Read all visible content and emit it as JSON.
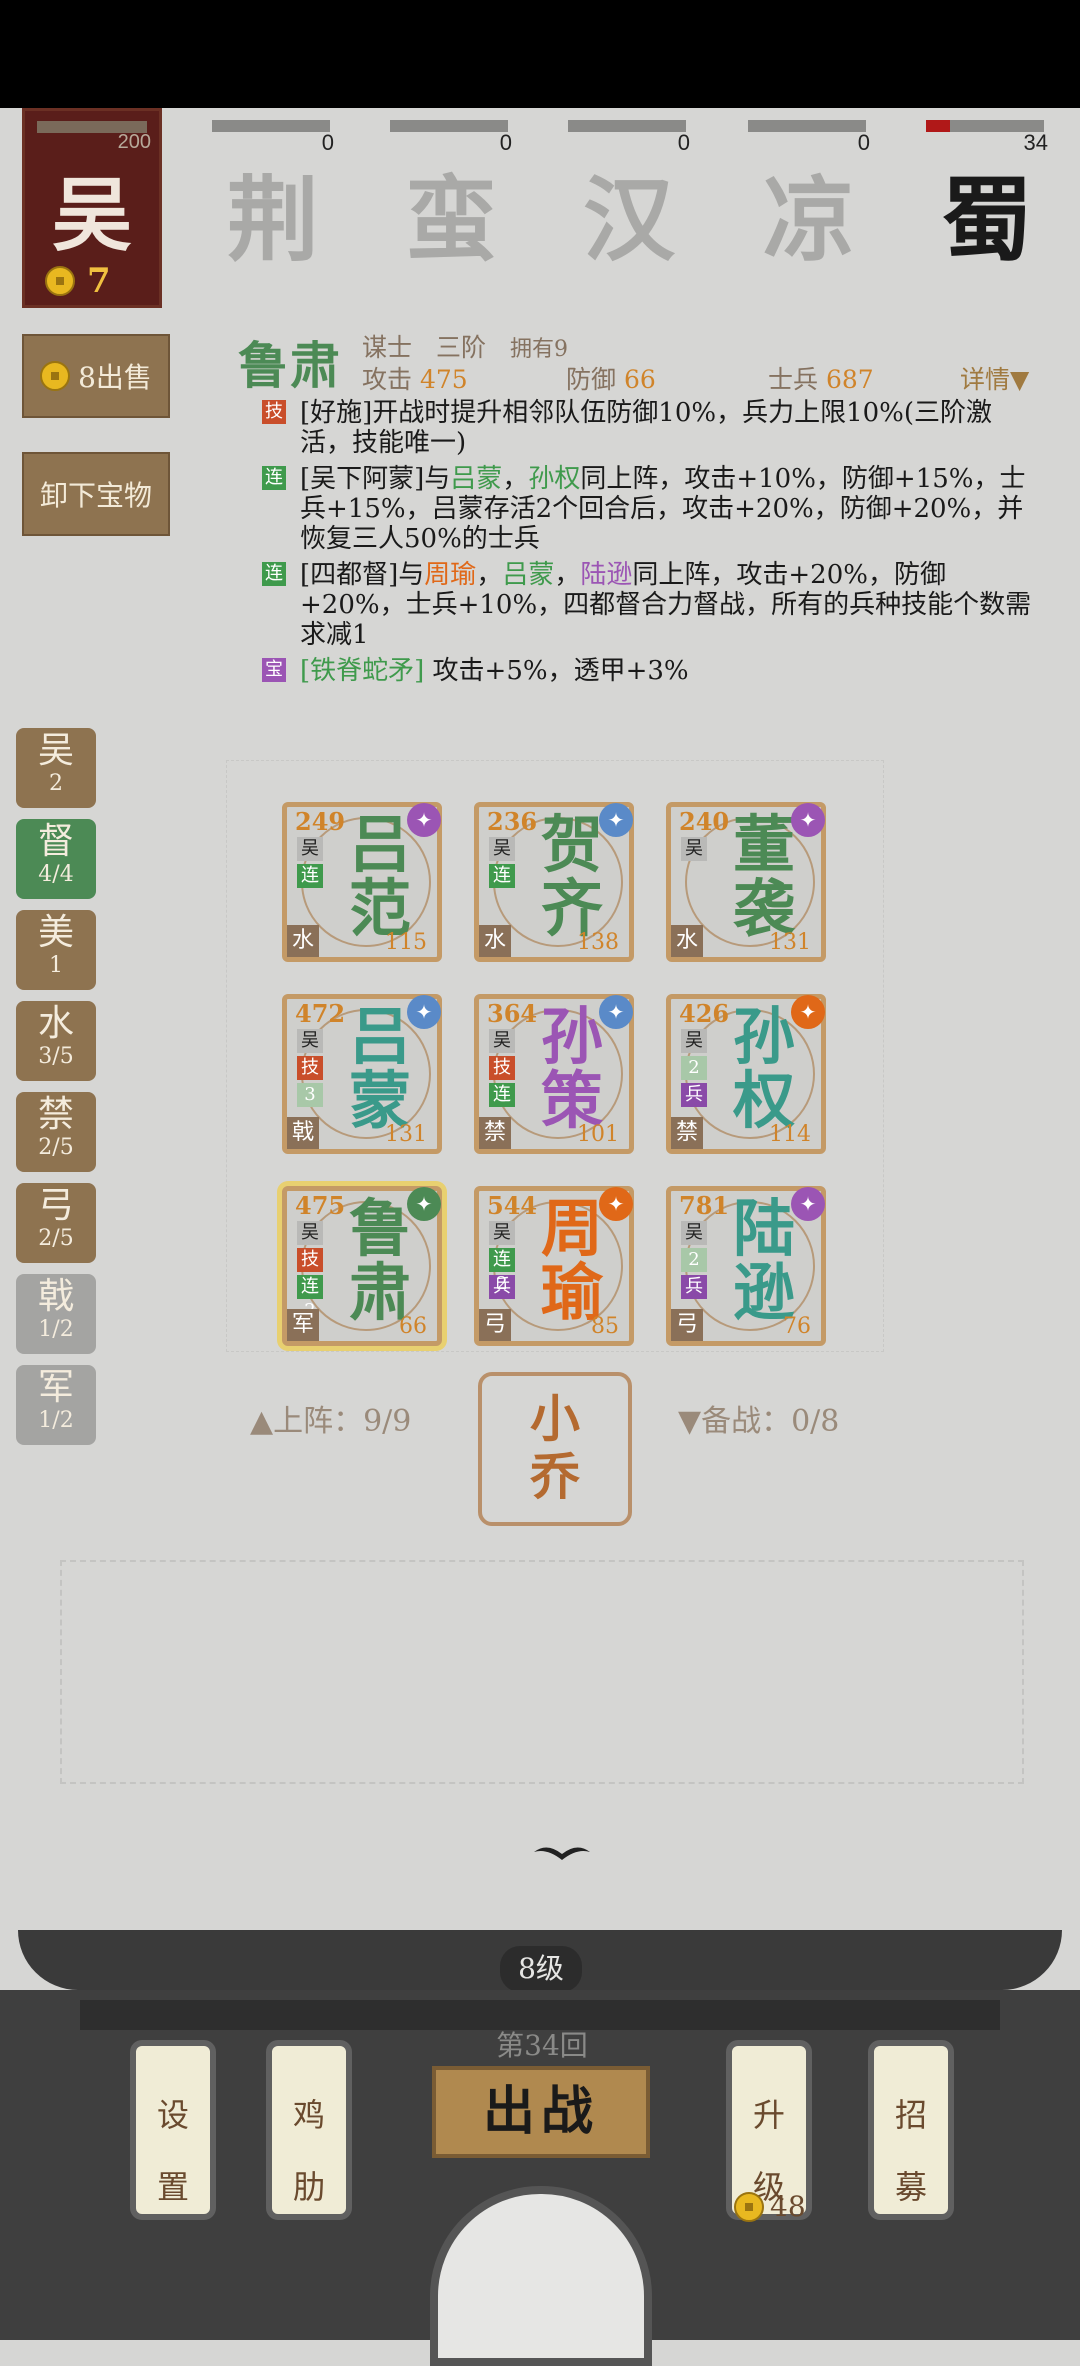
{
  "player": {
    "faction": "吴",
    "hp": "200",
    "coins": "7"
  },
  "enemies": [
    {
      "name": "荆",
      "score": "0",
      "fill": 0
    },
    {
      "name": "蛮",
      "score": "0",
      "fill": 0
    },
    {
      "name": "汉",
      "score": "0",
      "fill": 0
    },
    {
      "name": "凉",
      "score": "0",
      "fill": 0
    },
    {
      "name": "蜀",
      "score": "34",
      "fill": 0.2
    }
  ],
  "buttons": {
    "sell": "8出售",
    "unequip": "卸下宝物"
  },
  "general": {
    "name": "鲁肃",
    "role": "谋士",
    "rank": "三阶",
    "owned": "拥有9",
    "atk_label": "攻击",
    "atk": "475",
    "def_label": "防御",
    "def": "66",
    "troops_label": "士兵",
    "troops": "687",
    "detail": "详情"
  },
  "skills": [
    {
      "tag": "技",
      "color": "#c94e2a",
      "text": "[好施]开战时提升相邻队伍防御10%，兵力上限10%(三阶激活，技能唯一)"
    },
    {
      "tag": "连",
      "color": "#3f9a4c",
      "p1": "[吴下阿蒙]与",
      "n1": "吕蒙",
      "p2": "，",
      "n2": "孙权",
      "p3": "同上阵，攻击+10%，防御+15%，士兵+15%，吕蒙存活2个回合后，攻击+20%，防御+20%，并恢复三人50%的士兵"
    },
    {
      "tag": "连",
      "color": "#3f9a4c",
      "p1": "[四都督]与",
      "n1": "周瑜",
      "p2": "，",
      "n2": "吕蒙",
      "p3": "，",
      "n3": "陆逊",
      "p4": "同上阵，攻击+20%，防御+20%，士兵+10%，四都督合力督战，所有的兵种技能个数需求减1"
    },
    {
      "tag": "宝",
      "color": "#9b55b4",
      "p1": "[铁脊蛇矛]",
      "p2": " 攻击+5%，透甲+3%"
    }
  ],
  "filters": [
    {
      "label": "吴",
      "count": "2",
      "style": "brown"
    },
    {
      "label": "督",
      "count": "4/4",
      "style": "green"
    },
    {
      "label": "美",
      "count": "1",
      "style": "brown"
    },
    {
      "label": "水",
      "count": "3/5",
      "style": "brown"
    },
    {
      "label": "禁",
      "count": "2/5",
      "style": "brown"
    },
    {
      "label": "弓",
      "count": "2/5",
      "style": "brown"
    },
    {
      "label": "戟",
      "count": "1/2",
      "style": "gray"
    },
    {
      "label": "军",
      "count": "1/2",
      "style": "gray"
    }
  ],
  "units": [
    {
      "c1": "吕",
      "c2": "范",
      "hp": "249",
      "atk": "115",
      "type": "水",
      "tags": [
        "吴",
        "连"
      ],
      "color": "#4c8a55",
      "badge": "#9b55b4"
    },
    {
      "c1": "贺",
      "c2": "齐",
      "hp": "236",
      "atk": "138",
      "type": "水",
      "tags": [
        "吴",
        "连"
      ],
      "color": "#4c8a55",
      "badge": "#5a8ac8"
    },
    {
      "c1": "董",
      "c2": "袭",
      "hp": "240",
      "atk": "131",
      "type": "水",
      "tags": [
        "吴"
      ],
      "color": "#4c8a55",
      "badge": "#9b55b4"
    },
    {
      "c1": "吕",
      "c2": "蒙",
      "hp": "472",
      "atk": "131",
      "type": "戟",
      "tags": [
        "吴",
        "技",
        "3"
      ],
      "color": "#3a9a8a",
      "badge": "#5a8ac8"
    },
    {
      "c1": "孙",
      "c2": "策",
      "hp": "364",
      "atk": "101",
      "type": "禁",
      "tags": [
        "吴",
        "技",
        "连"
      ],
      "color": "#9b55b4",
      "badge": "#5a8ac8"
    },
    {
      "c1": "孙",
      "c2": "权",
      "hp": "426",
      "atk": "114",
      "type": "禁",
      "tags": [
        "吴",
        "2",
        "兵"
      ],
      "color": "#3a9a8a",
      "badge": "#e06818"
    },
    {
      "c1": "鲁",
      "c2": "肃",
      "hp": "475",
      "atk": "66",
      "type": "军",
      "tags": [
        "吴",
        "技",
        "连2"
      ],
      "color": "#4c8a55",
      "badge": "#4c8a55",
      "selected": true
    },
    {
      "c1": "周",
      "c2": "瑜",
      "hp": "544",
      "atk": "85",
      "type": "弓",
      "tags": [
        "吴",
        "连2",
        "兵"
      ],
      "color": "#e06818",
      "badge": "#e06818"
    },
    {
      "c1": "陆",
      "c2": "逊",
      "hp": "781",
      "atk": "76",
      "type": "弓",
      "tags": [
        "吴",
        "2",
        "兵"
      ],
      "color": "#3a9a8a",
      "badge": "#9b55b4"
    }
  ],
  "deploy": {
    "on": "▲上阵：9/9",
    "reserve_label": "▼备战：0/8"
  },
  "reserve": {
    "c1": "小",
    "c2": "乔"
  },
  "bottom": {
    "level": "8级",
    "round": "第34回",
    "fight": "出战",
    "settings": [
      "设",
      "置"
    ],
    "rib": [
      "鸡",
      "肋"
    ],
    "upgrade": [
      "升",
      "级"
    ],
    "upgrade_cost": "48",
    "recruit": [
      "招",
      "募"
    ]
  },
  "colors": {
    "accent": "#8e7350",
    "green": "#4c8a55",
    "purple": "#9b55b4",
    "orange": "#e06818"
  }
}
